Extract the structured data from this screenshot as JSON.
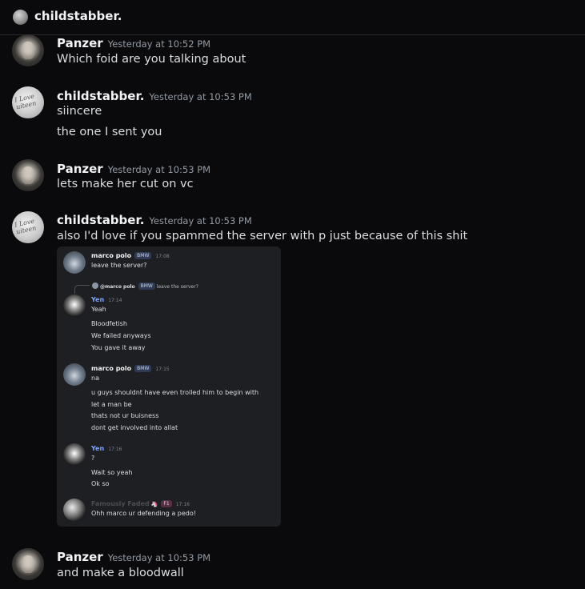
{
  "header": {
    "title": "childstabber.",
    "icon": "server-avatar-icon"
  },
  "messages": [
    {
      "author": "Panzer",
      "timestamp": "Yesterday at 10:52 PM",
      "lines": [
        "Which foid are you talking about"
      ]
    },
    {
      "author": "childstabber.",
      "timestamp": "Yesterday at 10:53 PM",
      "lines": [
        "siincere",
        "the one I sent you"
      ]
    },
    {
      "author": "Panzer",
      "timestamp": "Yesterday at 10:53 PM",
      "lines": [
        "lets make her cut on vc"
      ]
    },
    {
      "author": "childstabber.",
      "timestamp": "Yesterday at 10:53 PM",
      "lines": [
        "also I'd love if you spammed the server with p just because of this shit"
      ]
    },
    {
      "author": "Panzer",
      "timestamp": "Yesterday at 10:53 PM",
      "lines": [
        "and make a bloodwall"
      ]
    }
  ],
  "avatar_scribble": "I Love\nuiteen",
  "embed": {
    "m1": {
      "author": "marco polo",
      "tag": "BMW",
      "time": "17:08",
      "lines": [
        "leave the server?"
      ]
    },
    "reply": {
      "mention": "@marco polo",
      "tag": "BMW",
      "text": "leave the server?"
    },
    "m2": {
      "author": "Yen",
      "time": "17:14",
      "lines": [
        "Yeah",
        "Bloodfetish",
        "We failed anyways",
        "You gave it away"
      ]
    },
    "m3": {
      "author": "marco polo",
      "tag": "BMW",
      "time": "17:15",
      "lines": [
        "na",
        "u guys shouldnt have even trolled him to begin with",
        "let a man be",
        "thats not ur buisness",
        "dont get involved into allat"
      ]
    },
    "m4": {
      "author": "Yen",
      "time": "17:16",
      "lines": [
        "?",
        "Wait so yeah",
        "Ok so"
      ]
    },
    "m5": {
      "author": "Famously Faded",
      "emoji": "🦄",
      "tag": "F1",
      "time": "17:16",
      "lines": [
        "Ohh marco ur defending a pedo!"
      ]
    }
  },
  "colors": {
    "background": "#0a0a0c",
    "embed_bg": "#1e1f22",
    "yen_name": "#7aa7ff"
  }
}
